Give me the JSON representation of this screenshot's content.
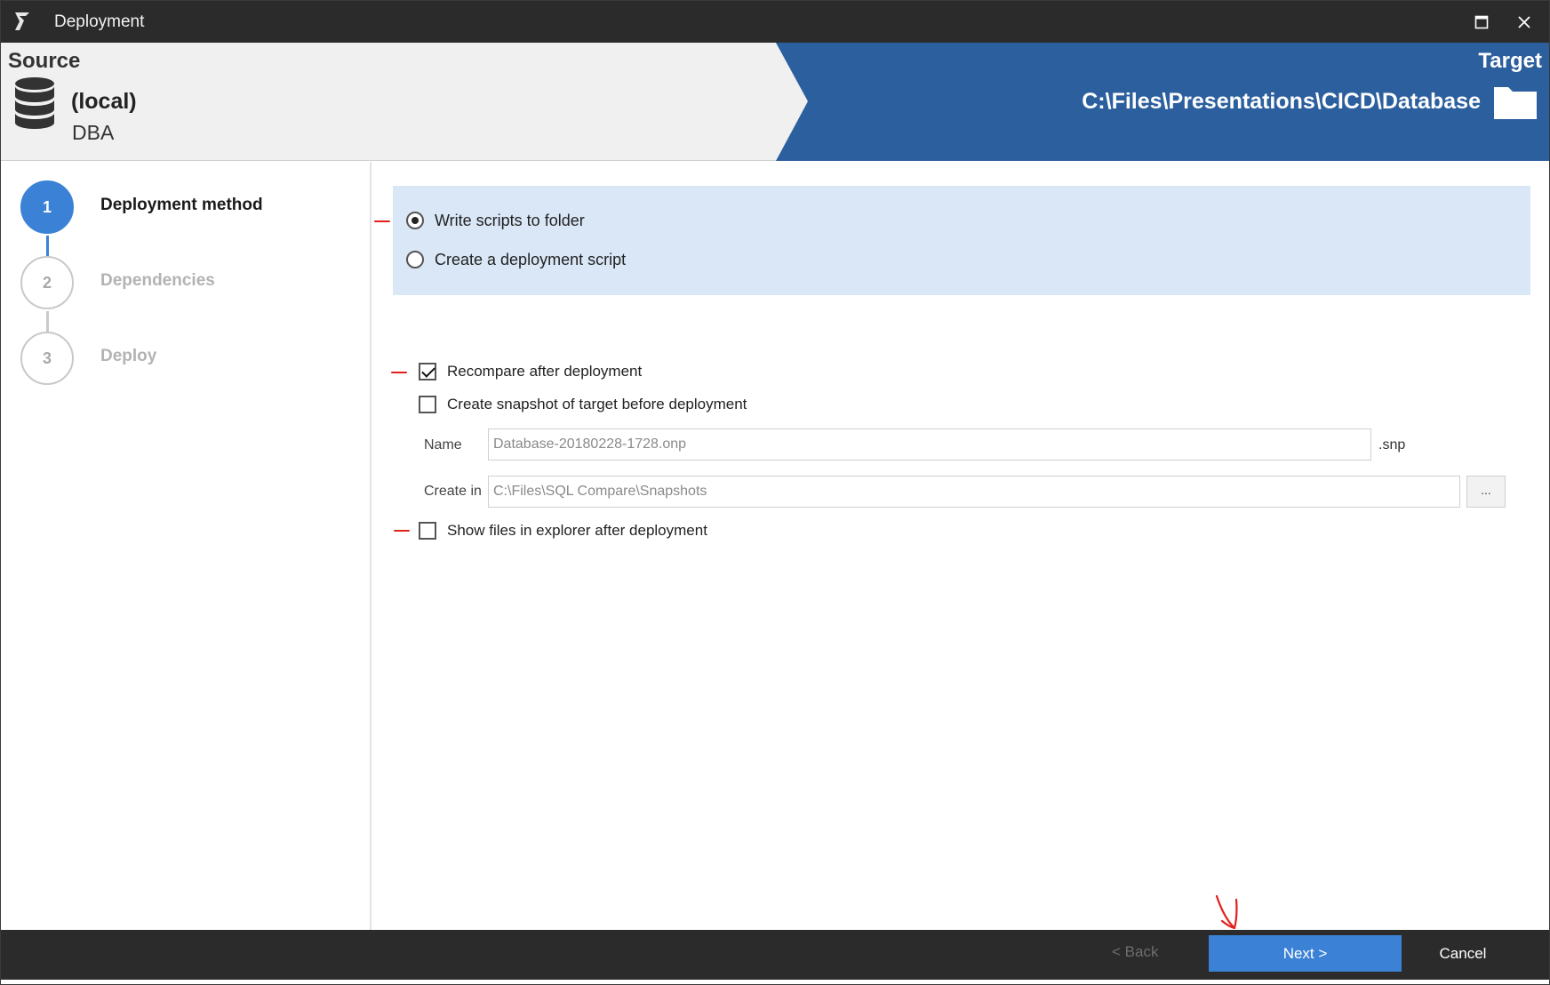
{
  "window": {
    "title": "Deployment",
    "app_icon": "sql-compare-logo-icon",
    "maximize_icon": "maximize-icon",
    "close_icon": "close-icon"
  },
  "source": {
    "label": "Source",
    "server": "(local)",
    "database": "DBA",
    "icon": "database-icon"
  },
  "target": {
    "label": "Target",
    "path": "C:\\Files\\Presentations\\CICD\\Database",
    "icon": "folder-icon"
  },
  "steps": [
    {
      "number": "1",
      "label": "Deployment method",
      "active": true
    },
    {
      "number": "2",
      "label": "Dependencies",
      "active": false
    },
    {
      "number": "3",
      "label": "Deploy",
      "active": false
    }
  ],
  "deployment_method": {
    "options": [
      {
        "label": "Write scripts to folder",
        "selected": true
      },
      {
        "label": "Create a deployment script",
        "selected": false
      }
    ]
  },
  "options": {
    "recompare_label": "Recompare after deployment",
    "recompare_checked": true,
    "snapshot_label": "Create snapshot of target before deployment",
    "snapshot_checked": false,
    "name_label": "Name",
    "name_value": "Database-20180228-1728.onp",
    "name_suffix": ".snp",
    "create_in_label": "Create in",
    "create_in_value": "C:\\Files\\SQL Compare\\Snapshots",
    "browse_label": "...",
    "show_files_label": "Show files in explorer after deployment",
    "show_files_checked": false
  },
  "footer": {
    "back_label": "< Back",
    "next_label": "Next >",
    "cancel_label": "Cancel"
  },
  "colors": {
    "accent": "#3b82d6",
    "target_banner": "#2c5f9e",
    "title_bar": "#2b2b2b",
    "method_box": "#d9e7f7",
    "annotation": "#e0201c"
  }
}
